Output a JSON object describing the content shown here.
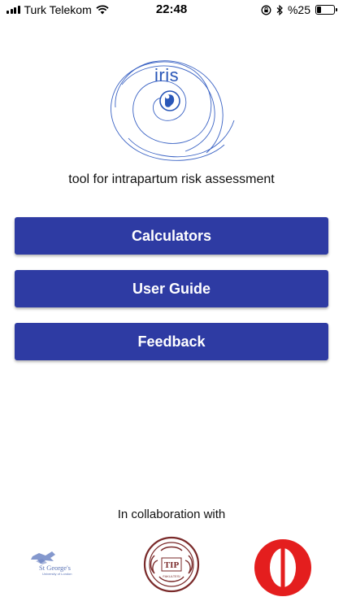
{
  "status_bar": {
    "carrier": "Turk Telekom",
    "time": "22:48",
    "battery_percent": "%25",
    "battery_level": 0.25
  },
  "logo": {
    "text": "iris"
  },
  "tagline": "tool for intrapartum risk assessment",
  "buttons": {
    "calculators": "Calculators",
    "user_guide": "User Guide",
    "feedback": "Feedback"
  },
  "collaboration": {
    "label": "In collaboration with",
    "partners": {
      "st_georges": "St George's",
      "st_georges_sub": "University of London",
      "tip": "TIP",
      "tip_sub": "FAKULTESI"
    }
  },
  "colors": {
    "button": "#2e3ba3",
    "logo_blue": "#2a57b8"
  }
}
